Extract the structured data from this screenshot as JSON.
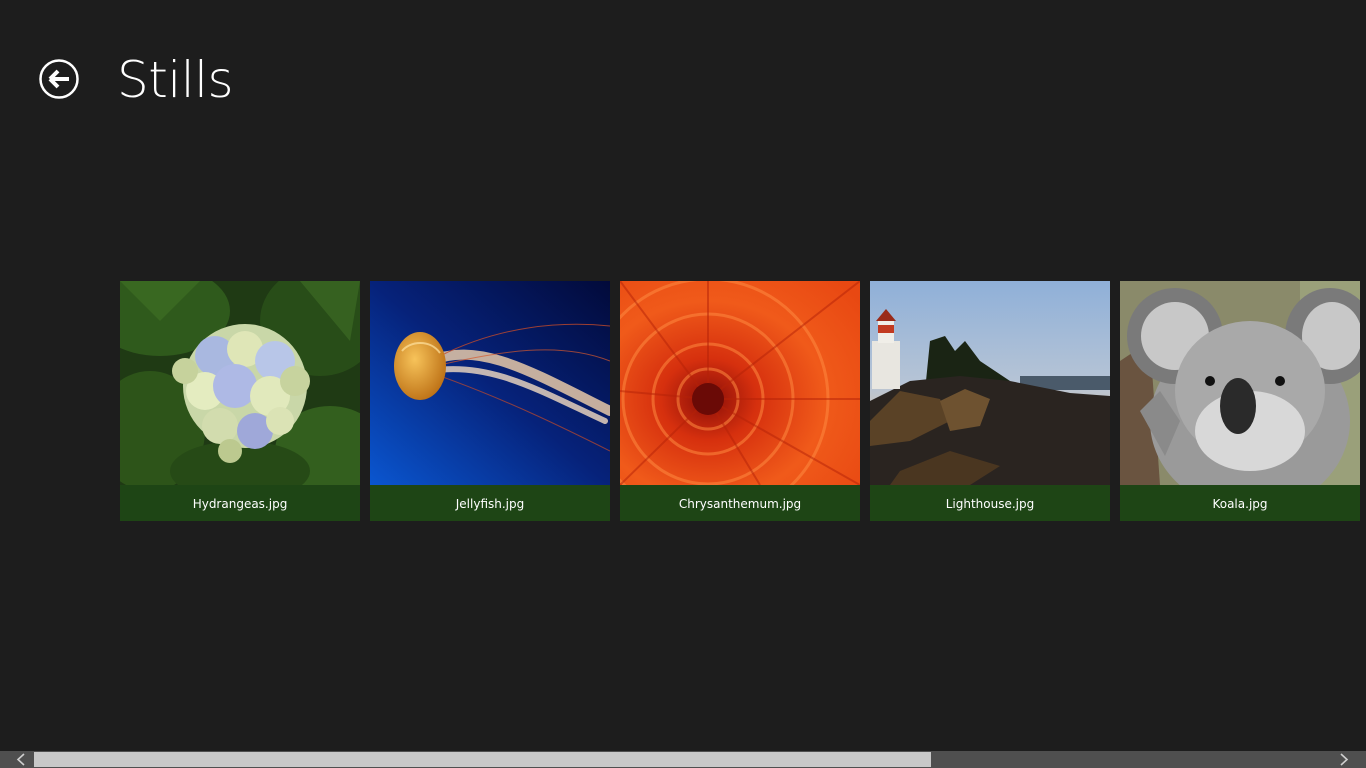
{
  "header": {
    "title": "Stills",
    "back_icon": "back-arrow-circle-icon"
  },
  "colors": {
    "background": "#1d1d1d",
    "caption_bar": "#1e4515",
    "scrollbar_track": "#4f4f4f",
    "scrollbar_thumb": "#c8c8c8",
    "text": "#ffffff"
  },
  "gallery": {
    "items": [
      {
        "filename": "Hydrangeas.jpg",
        "thumbnail": "hydrangea-photo"
      },
      {
        "filename": "Jellyfish.jpg",
        "thumbnail": "jellyfish-photo"
      },
      {
        "filename": "Chrysanthemum.jpg",
        "thumbnail": "chrysanthemum-photo"
      },
      {
        "filename": "Lighthouse.jpg",
        "thumbnail": "lighthouse-photo"
      },
      {
        "filename": "Koala.jpg",
        "thumbnail": "koala-photo"
      }
    ]
  },
  "scrollbar": {
    "left_icon": "chevron-left-icon",
    "right_icon": "chevron-right-icon",
    "thumb_start_fraction": 0.025,
    "thumb_size_fraction": 0.657
  }
}
